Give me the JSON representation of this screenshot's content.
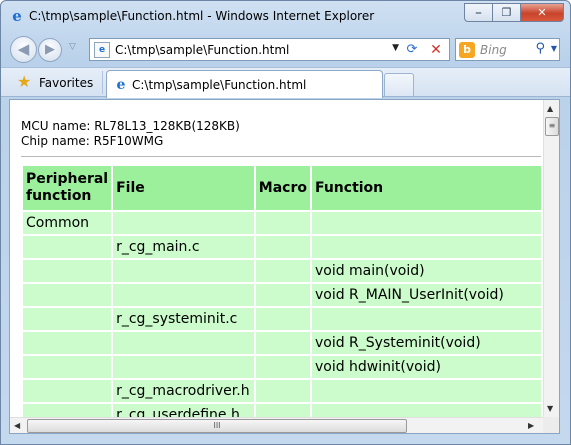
{
  "window": {
    "title": "C:\\tmp\\sample\\Function.html - Windows Internet Explorer",
    "min_glyph": "⎯",
    "max_glyph": "❐",
    "close_glyph": "✕"
  },
  "nav": {
    "back_glyph": "◀",
    "forward_glyph": "▶",
    "history_glyph": "▽",
    "address": "C:\\tmp\\sample\\Function.html",
    "address_icon": "e",
    "dropdown_glyph": "▼",
    "refresh_glyph": "⟳",
    "stop_glyph": "✕",
    "search_placeholder": "Bing",
    "search_icon": "b",
    "search_go_glyph": "⚲",
    "search_drop_glyph": "▼"
  },
  "favorites": {
    "label": "Favorites",
    "star_glyph": "★",
    "tab_label": "C:\\tmp\\sample\\Function.html",
    "tab_icon": "e"
  },
  "page": {
    "mcu_name": "MCU name: RL78L13_128KB(128KB)",
    "chip_name": "Chip name: R5F10WMG"
  },
  "table": {
    "headers": [
      "Peripheral function",
      "File",
      "Macro",
      "Function"
    ],
    "rows": [
      [
        "Common",
        "",
        "",
        ""
      ],
      [
        "",
        "r_cg_main.c",
        "",
        ""
      ],
      [
        "",
        "",
        "",
        "void main(void)"
      ],
      [
        "",
        "",
        "",
        "void R_MAIN_UserInit(void)"
      ],
      [
        "",
        "r_cg_systeminit.c",
        "",
        ""
      ],
      [
        "",
        "",
        "",
        "void R_Systeminit(void)"
      ],
      [
        "",
        "",
        "",
        "void hdwinit(void)"
      ],
      [
        "",
        "r_cg_macrodriver.h",
        "",
        ""
      ],
      [
        "",
        "r_cg_userdefine.h",
        "",
        ""
      ]
    ]
  },
  "scrollbars": {
    "up_glyph": "▲",
    "down_glyph": "▼",
    "left_glyph": "◀",
    "right_glyph": "▶",
    "grip_v": "≡",
    "grip_h": "III"
  },
  "colors": {
    "header_bg": "#9cf09c",
    "cell_bg": "#ccfccc"
  }
}
